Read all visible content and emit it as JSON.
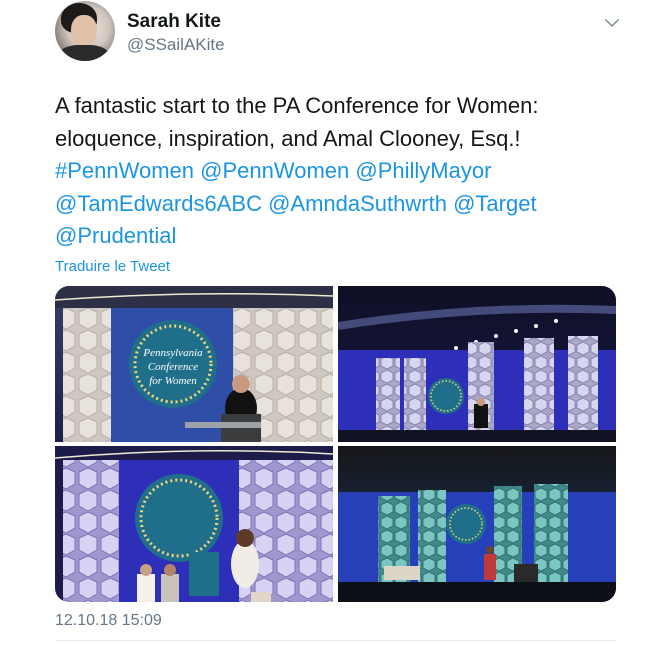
{
  "user": {
    "name": "Sarah Kite",
    "handle": "@SSailAKite"
  },
  "tweet": {
    "text": "A fantastic start to the PA Conference for Women: eloquence, inspiration, and Amal Clooney, Esq.!",
    "tags": [
      "#PennWomen",
      "@PennWomen",
      "@PhillyMayor",
      "@TamEdwards6ABC",
      "@AmndaSuthwrth",
      "@Target",
      "@Prudential"
    ],
    "translate_label": "Traduire le Tweet",
    "timestamp": "12.10.18 15:09"
  },
  "photos": {
    "logo_line1": "Pennsylvania",
    "logo_line2": "Conference",
    "logo_line3": "for Women"
  },
  "icons": {
    "more": "chevron-down-icon",
    "avatar": "avatar"
  },
  "colors": {
    "link": "#1b95e0",
    "secondary_text": "#657786",
    "primary_text": "#14171a",
    "stage_blue": "#2d2fb8",
    "logo_teal": "#1f6f8b"
  }
}
